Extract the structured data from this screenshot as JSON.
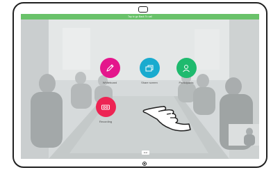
{
  "banner": {
    "text": "Tap to go Back To call",
    "color": "#69c26a"
  },
  "tiles": [
    {
      "label": "Whiteboard",
      "icon": "pencil-icon",
      "color": "#e4168c"
    },
    {
      "label": "Share screen",
      "icon": "share-screen-icon",
      "color": "#1aabcf"
    },
    {
      "label": "Participants",
      "icon": "person-icon",
      "color": "#1fba6e"
    },
    {
      "label": "Recording",
      "icon": "record-icon",
      "color": "#ed2453"
    }
  ],
  "call": {
    "end_label": "End"
  }
}
